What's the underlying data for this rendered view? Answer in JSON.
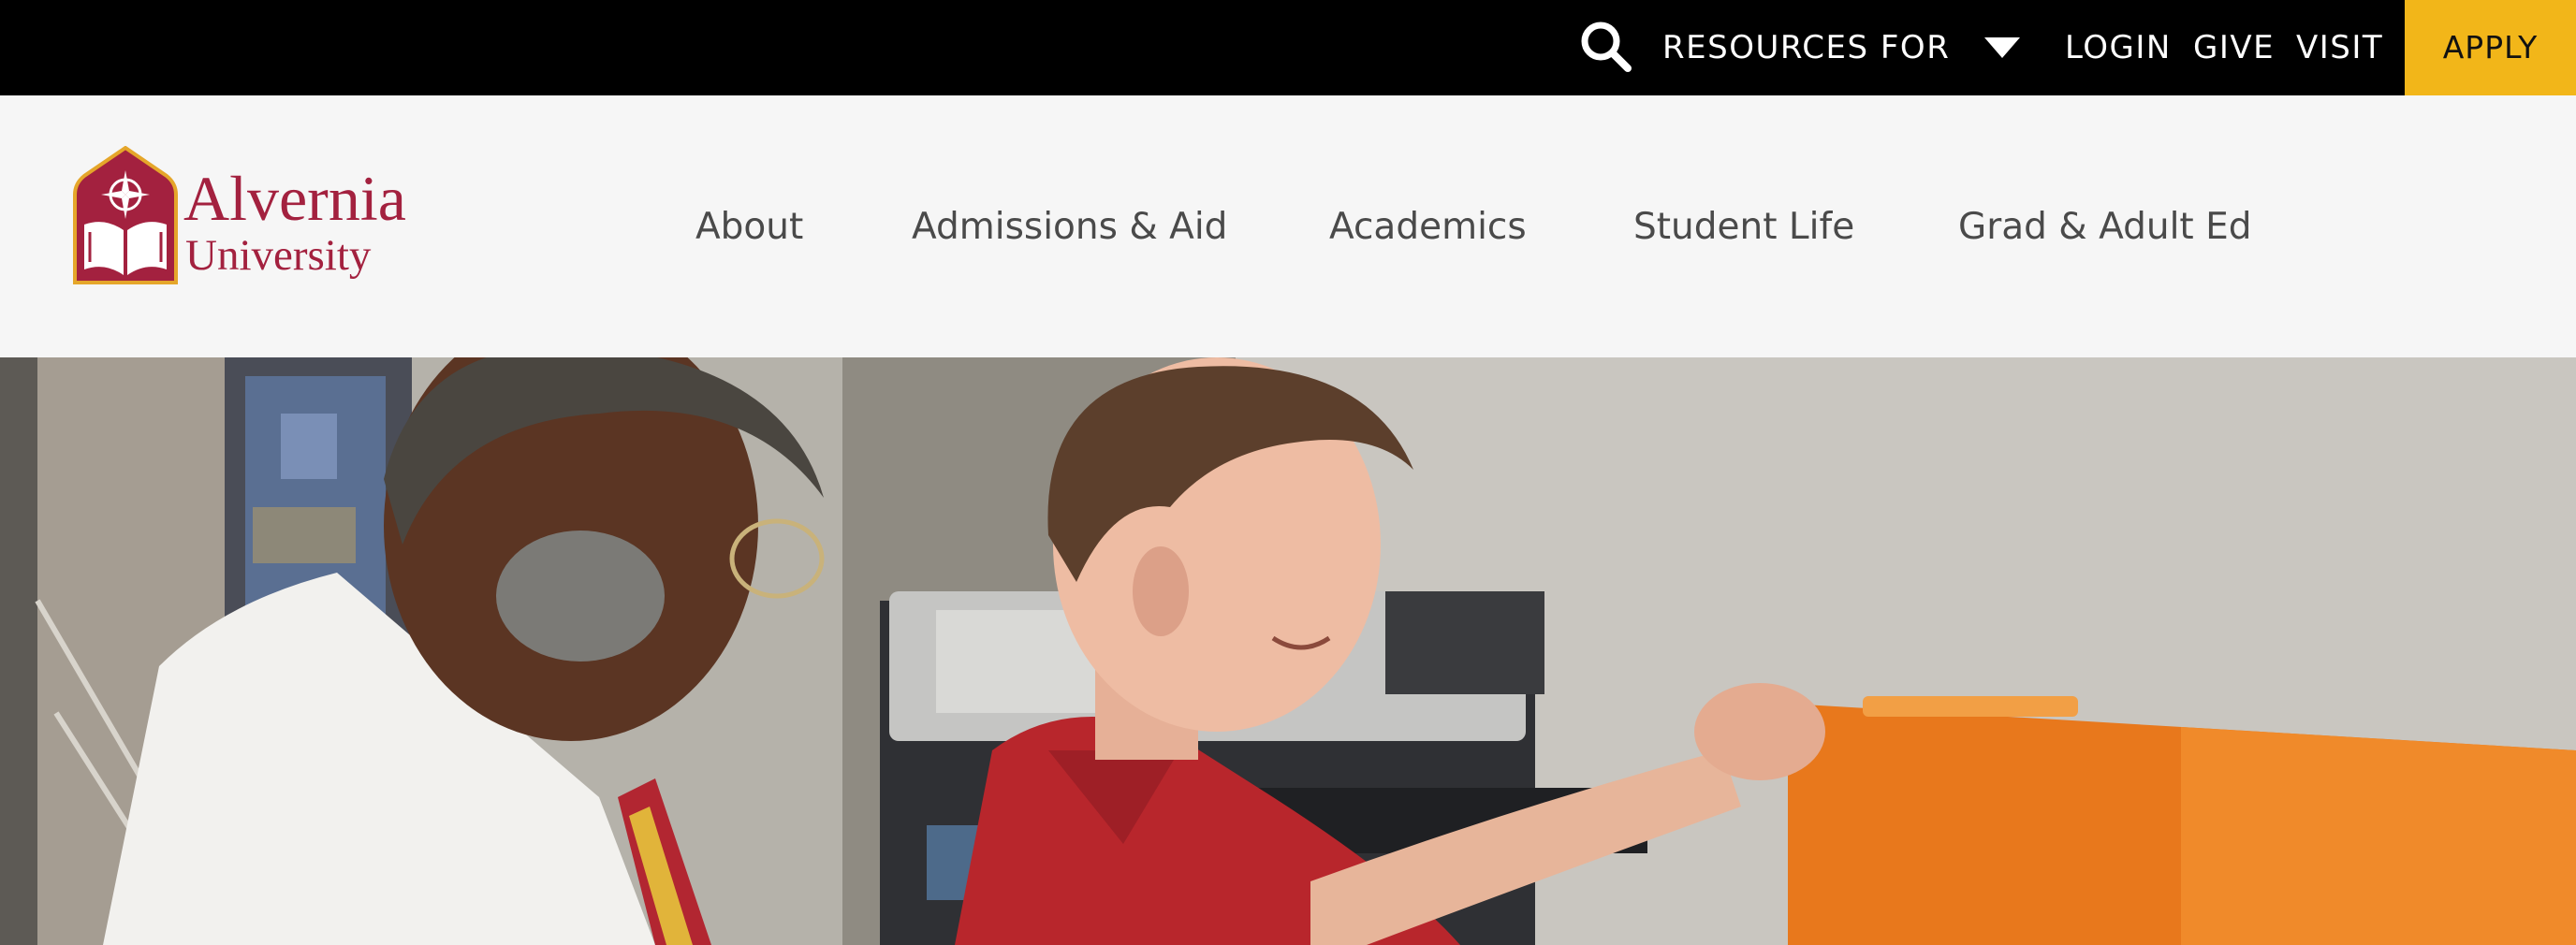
{
  "utility_bar": {
    "resources_label": "RESOURCES FOR",
    "login_label": "LOGIN",
    "give_label": "GIVE",
    "visit_label": "VISIT",
    "apply_label": "APPLY"
  },
  "logo": {
    "line1": "Alvernia",
    "line2": "University"
  },
  "nav": {
    "items": [
      {
        "label": "About"
      },
      {
        "label": "Admissions & Aid"
      },
      {
        "label": "Academics"
      },
      {
        "label": "Student Life"
      },
      {
        "label": "Grad & Adult Ed"
      }
    ]
  },
  "icons": {
    "search": "search-icon",
    "dropdown": "chevron-down-icon",
    "logo_mark": "shield-compass-book-icon"
  },
  "colors": {
    "utility_bar": "#000000",
    "apply_accent": "#f2b619",
    "brand_maroon": "#a3213f",
    "header_bg": "#f6f6f6",
    "nav_text": "#4a4a4a"
  }
}
